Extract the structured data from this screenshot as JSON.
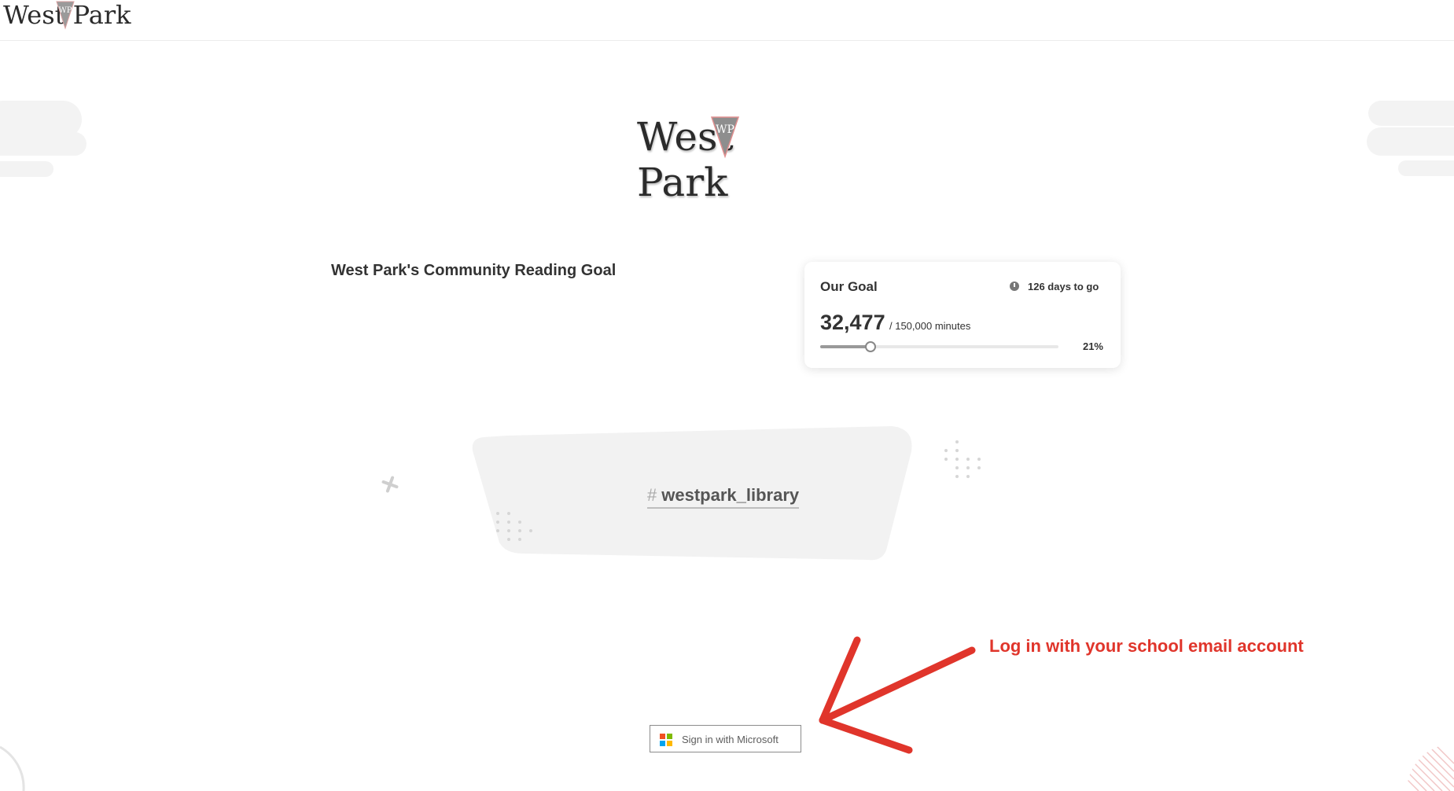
{
  "header": {
    "logo_text": "West Park",
    "logo_monogram": "WP"
  },
  "hero": {
    "logo_text": "West Park",
    "logo_monogram": "WP"
  },
  "goal": {
    "title": "West Park's Community Reading Goal",
    "card_label": "Our Goal",
    "days_to_go": "126 days to go",
    "current": "32,477",
    "target": "/ 150,000 minutes",
    "percent_text": "21%",
    "progress_fraction": 0.21
  },
  "banner": {
    "hash_symbol": "#",
    "hashtag": "westpark_library"
  },
  "annotation": {
    "text": "Log in with your school email account",
    "color": "#e0352b"
  },
  "signin": {
    "label": "Sign in with Microsoft"
  },
  "icons": [
    "clock-icon",
    "microsoft-logo-icon",
    "arrow-icon"
  ]
}
